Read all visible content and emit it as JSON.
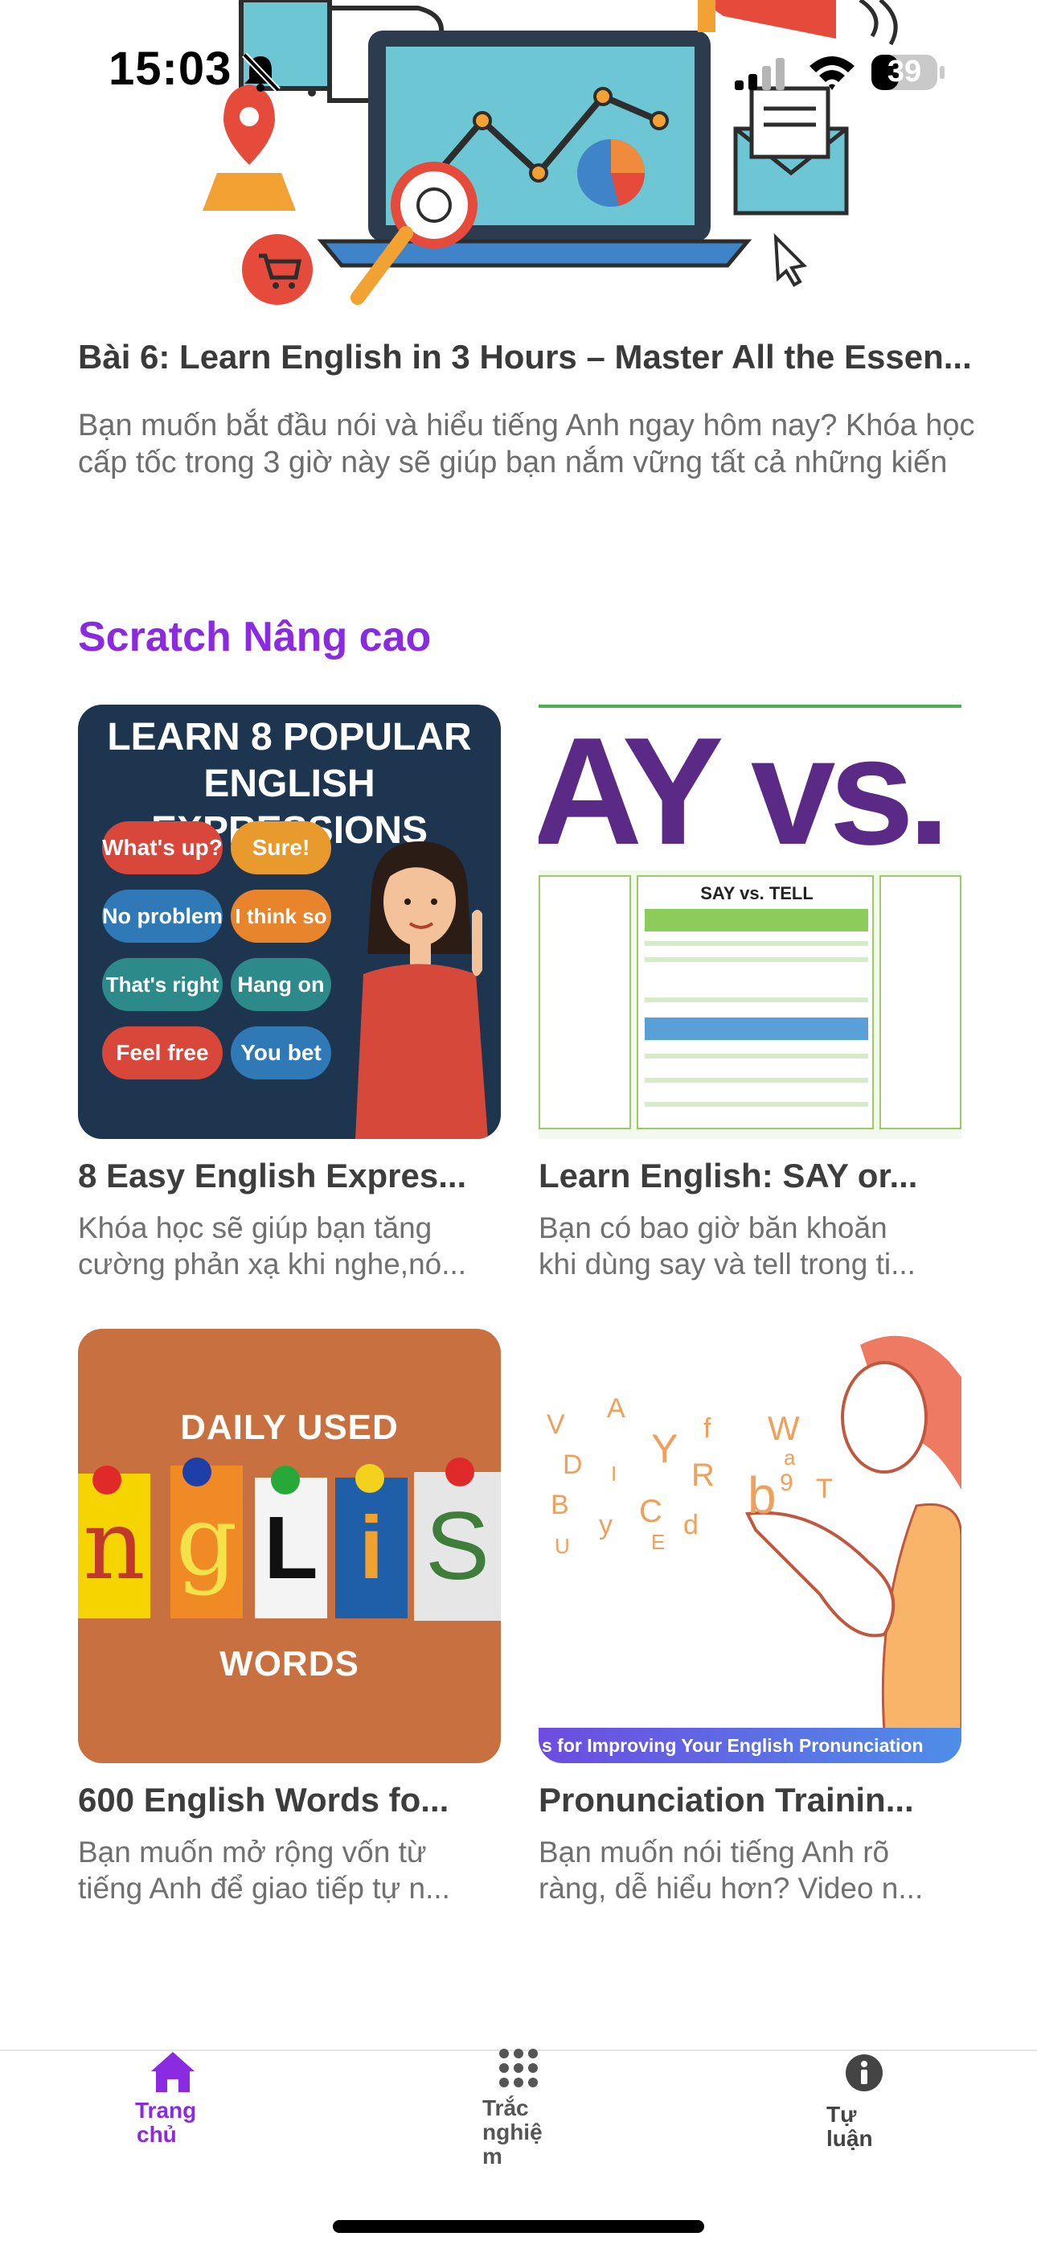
{
  "status_bar": {
    "time": "15:03",
    "battery": "39",
    "icons": [
      "bell-slash-icon",
      "cellular-signal-icon",
      "wifi-icon",
      "battery-icon"
    ]
  },
  "top_article": {
    "title": "Bài 6: Learn English in 3 Hours – Master All the Essen...",
    "description_line1": "Bạn muốn bắt đầu nói và hiểu tiếng Anh ngay hôm nay? Khóa học",
    "description_line2": "cấp tốc trong 3 giờ này sẽ giúp bạn nắm vững tất cả những kiến"
  },
  "section": {
    "title": "Scratch Nâng cao",
    "title_color": "#8a2be2",
    "cards": [
      {
        "title": "8 Easy English Expres...",
        "description_line1": "Khóa học sẽ giúp bạn tăng",
        "description_line2": "cường phản xạ khi nghe,nó...",
        "thumb": {
          "heading_line1": "LEARN 8 POPULAR",
          "heading_line2": "ENGLISH EXPRESSIONS",
          "bubbles": [
            "What's up?",
            "Sure!",
            "No problem",
            "I think so",
            "That's right",
            "Hang on",
            "Feel free",
            "You bet"
          ]
        }
      },
      {
        "title": "Learn English: SAY or...",
        "description_line1": "Bạn có bao giờ băn khoăn",
        "description_line2": "khi dùng say và tell trong ti...",
        "thumb": {
          "heading": "AY vs. TE",
          "panel_title": "SAY vs. TELL"
        }
      },
      {
        "title": "600 English Words fo...",
        "description_line1": "Bạn muốn mở rộng vốn từ",
        "description_line2": "tiếng Anh để giao tiếp tự n...",
        "thumb": {
          "top_text": "DAILY USED",
          "letters": [
            "n",
            "g",
            "L",
            "i",
            "S"
          ],
          "bottom_text": "WORDS"
        }
      },
      {
        "title": "Pronunciation Trainin...",
        "description_line1": "Bạn muốn nói tiếng Anh rõ",
        "description_line2": "ràng, dễ hiểu hơn? Video n...",
        "thumb": {
          "banner": "s for Improving Your English Pronunciation",
          "letters": [
            "V",
            "A",
            "Y",
            "f",
            "W",
            "D",
            "I",
            "R",
            "a",
            "b",
            "9",
            "T",
            "B",
            "C",
            "y",
            "d",
            "E",
            "U"
          ]
        }
      }
    ]
  },
  "bottom_nav": {
    "active_color": "#8a2be2",
    "items": [
      {
        "label_line1": "Trang",
        "label_line2": "chủ",
        "label_line3": "",
        "icon": "home-icon"
      },
      {
        "label_line1": "Trắc",
        "label_line2": "nghiệ",
        "label_line3": "m",
        "icon": "grid-icon"
      },
      {
        "label_line1": "Tự",
        "label_line2": "luận",
        "label_line3": "",
        "icon": "info-icon"
      }
    ]
  }
}
